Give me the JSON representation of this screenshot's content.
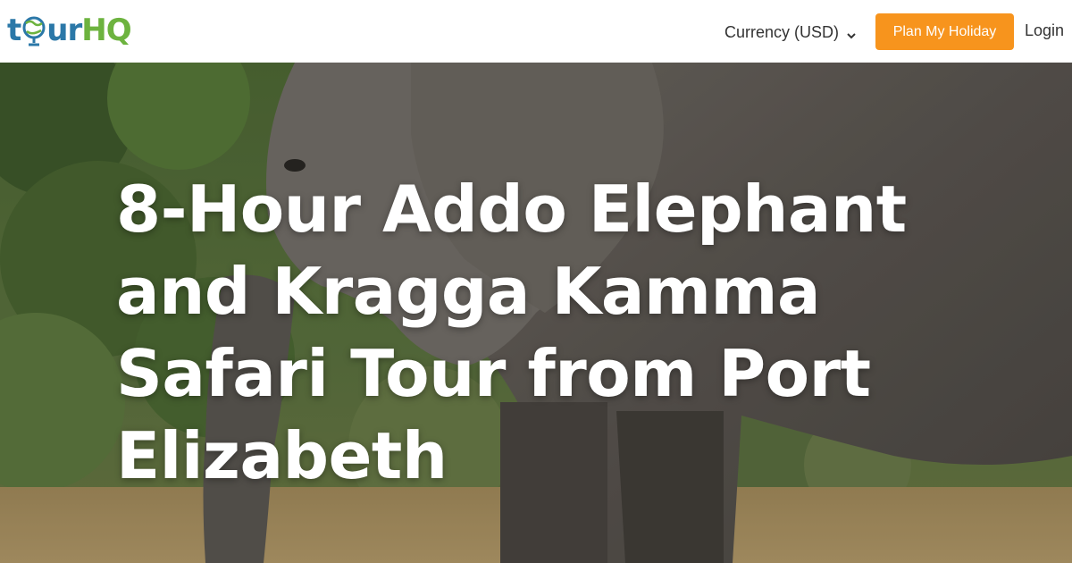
{
  "header": {
    "logo_text": "tourHQ",
    "currency_label": "Currency (USD)",
    "plan_button_label": "Plan My Holiday",
    "login_label": "Login"
  },
  "hero": {
    "title": "8-Hour Addo Elephant and Kragga Kamma Safari Tour from Port Elizabeth"
  },
  "colors": {
    "brand_blue": "#2b78a8",
    "brand_green": "#6db33f",
    "accent_orange": "#f7941d"
  },
  "icons": {
    "currency_dropdown": "chevron-down-icon",
    "logo_globe": "globe-icon"
  }
}
